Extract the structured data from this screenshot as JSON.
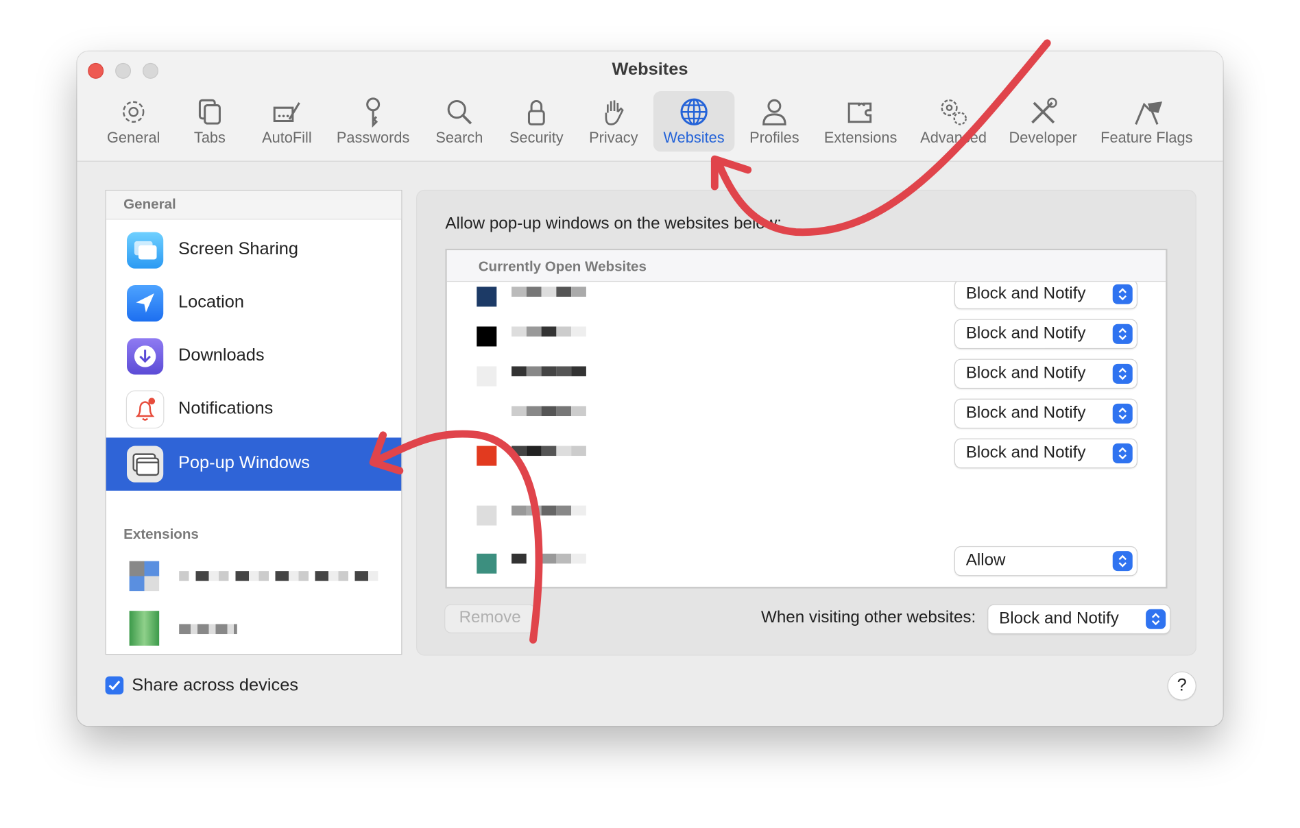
{
  "window": {
    "title": "Websites"
  },
  "toolbar": {
    "items": [
      {
        "label": "General",
        "icon": "gear-icon"
      },
      {
        "label": "Tabs",
        "icon": "tabs-icon"
      },
      {
        "label": "AutoFill",
        "icon": "autofill-icon"
      },
      {
        "label": "Passwords",
        "icon": "key-icon"
      },
      {
        "label": "Search",
        "icon": "magnifier-icon"
      },
      {
        "label": "Security",
        "icon": "lock-icon"
      },
      {
        "label": "Privacy",
        "icon": "hand-icon"
      },
      {
        "label": "Websites",
        "icon": "globe-icon",
        "active": true
      },
      {
        "label": "Profiles",
        "icon": "person-icon"
      },
      {
        "label": "Extensions",
        "icon": "puzzle-icon"
      },
      {
        "label": "Advanced",
        "icon": "gears-icon"
      },
      {
        "label": "Developer",
        "icon": "tools-icon"
      },
      {
        "label": "Feature Flags",
        "icon": "flags-icon"
      }
    ]
  },
  "sidebar": {
    "general_header": "General",
    "items": [
      {
        "label": "Screen Sharing",
        "icon": "screen-sharing-icon"
      },
      {
        "label": "Location",
        "icon": "location-icon"
      },
      {
        "label": "Downloads",
        "icon": "downloads-icon"
      },
      {
        "label": "Notifications",
        "icon": "notifications-icon"
      },
      {
        "label": "Pop-up Windows",
        "icon": "popup-windows-icon",
        "selected": true
      }
    ],
    "extensions_header": "Extensions"
  },
  "main": {
    "prompt": "Allow pop-up windows on the websites below:",
    "table_header": "Currently Open Websites",
    "rows": [
      {
        "setting": "Block and Notify"
      },
      {
        "setting": "Block and Notify"
      },
      {
        "setting": "Block and Notify"
      },
      {
        "setting": "Block and Notify"
      },
      {
        "setting": "Block and Notify"
      },
      {
        "setting": ""
      },
      {
        "setting": "Allow"
      }
    ],
    "remove_label": "Remove",
    "other_websites_label": "When visiting other websites:",
    "other_websites_value": "Block and Notify"
  },
  "footer": {
    "share_label": "Share across devices",
    "share_checked": true,
    "help_label": "?"
  },
  "colors": {
    "accent": "#2f64d7",
    "annotation": "#e0444b"
  }
}
